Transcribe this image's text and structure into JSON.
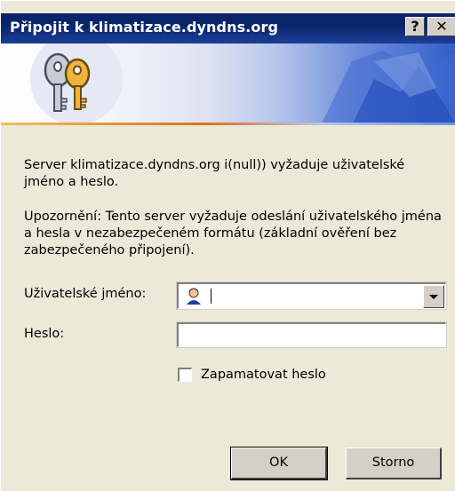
{
  "window": {
    "title": "Připojit k klimatizace.dyndns.org",
    "help_button": "?",
    "close_button": "✕"
  },
  "message": {
    "server_line": "Server klimatizace.dyndns.org i(null)) vyžaduje uživatelské jméno a heslo.",
    "warning_line": "Upozornění: Tento server vyžaduje odeslání uživatelského jména a hesla v nezabezpečeném formátu (základní ověření bez zabezpečeného připojení)."
  },
  "form": {
    "username_label": "Uživatelské jméno:",
    "username_value": "",
    "password_label": "Heslo:",
    "password_value": "",
    "remember_label": "Zapamatovat heslo",
    "remember_checked": false
  },
  "buttons": {
    "ok": "OK",
    "cancel": "Storno"
  },
  "icons": {
    "banner": "keys-icon",
    "user": "user-icon"
  }
}
